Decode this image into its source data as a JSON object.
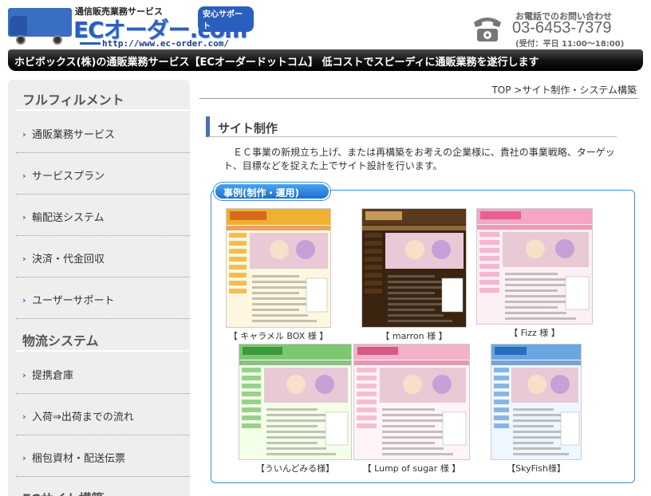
{
  "header": {
    "logo_sub": "通信販売業務サービス",
    "logo_main": "ECオーダー.com",
    "logo_badge": "安心サポート",
    "logo_url": "http://www.ec-order.com/",
    "phone_label": "お電話でのお問い合わせ",
    "phone_number": "03-6453-7379",
    "phone_hours": "(受付：平日 11:00～18:00)"
  },
  "banner": {
    "text": "ホビボックス(株)の通販業務サービス【ECオーダードットコム】 低コストでスピーディに通販業務を遂行します"
  },
  "sidebar": {
    "sections": [
      {
        "title": "フルフィルメント",
        "items": [
          "通販業務サービス",
          "サービスプラン",
          "輸配送システム",
          "決済・代金回収",
          "ユーザーサポート"
        ]
      },
      {
        "title": "物流システム",
        "items": [
          "提携倉庫",
          "入荷⇒出荷までの流れ",
          "梱包資材・配送伝票"
        ]
      },
      {
        "title": "ECサイト構築",
        "items": []
      }
    ],
    "arrow": "›"
  },
  "main": {
    "breadcrumb": "TOP >サイト制作・システム構築",
    "section_title": "サイト制作",
    "intro": "ＥＣ事業の新規立ち上げ、または再構築をお考えの企業様に、貴社の事業戦略、ターゲット、目標などを捉えた上でサイト設計を行います。",
    "cases_tab": "事例(制作・運用)",
    "cases": [
      {
        "caption": "【 キャラメル BOX 様 】",
        "theme": "#f0b030",
        "accent": "#d86a1a",
        "bg": "#fff7e0"
      },
      {
        "caption": "【 marron 様 】",
        "theme": "#5a3a1c",
        "accent": "#c59a5a",
        "bg": "#3a2410"
      },
      {
        "caption": "【 Fizz 様 】",
        "theme": "#f5a6c6",
        "accent": "#e8608e",
        "bg": "#fdf0f4"
      },
      {
        "caption": "【ういんどみる様】",
        "theme": "#7cc870",
        "accent": "#3c9a3a",
        "bg": "#f4ffe8"
      },
      {
        "caption": "【 Lump of sugar 様 】",
        "theme": "#f3b2c8",
        "accent": "#d45a88",
        "bg": "#fff4f8"
      },
      {
        "caption": "【SkyFish様】",
        "theme": "#6aa6e0",
        "accent": "#2a6cc0",
        "bg": "#eef6ff"
      }
    ]
  },
  "colors": {
    "brand_blue": "#2a5fc0",
    "banner_black": "#111111",
    "sidebar_bg": "#eeeeee",
    "frame_blue": "#3b8fd8"
  }
}
